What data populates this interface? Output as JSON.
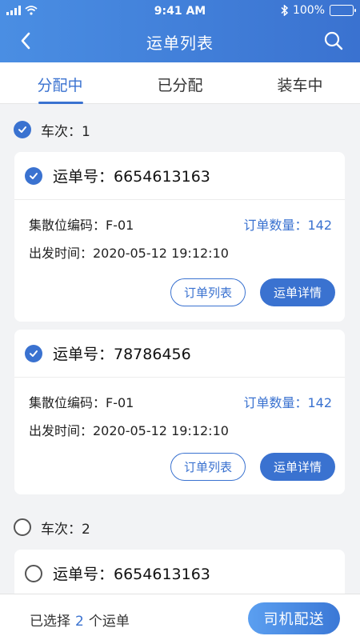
{
  "status_bar": {
    "time": "9:41 AM",
    "battery": "100%"
  },
  "header": {
    "title": "运单列表",
    "back_icon": "back-arrow-icon",
    "search_icon": "search-icon"
  },
  "tabs": [
    {
      "label": "分配中",
      "active": true
    },
    {
      "label": "已分配",
      "active": false
    },
    {
      "label": "装车中",
      "active": false
    }
  ],
  "groups": [
    {
      "label": "车次：1",
      "checked": true,
      "cards": [
        {
          "checked": true,
          "waybill": "运单号：6654613163",
          "location": "集散位编码：F-01",
          "order_count": "订单数量：142",
          "depart_time": "出发时间：2020-05-12  19:12:10",
          "btn_orders": "订单列表",
          "btn_detail": "运单详情"
        },
        {
          "checked": true,
          "waybill": "运单号：78786456",
          "location": "集散位编码：F-01",
          "order_count": "订单数量：142",
          "depart_time": "出发时间：2020-05-12  19:12:10",
          "btn_orders": "订单列表",
          "btn_detail": "运单详情"
        }
      ]
    },
    {
      "label": "车次：2",
      "checked": false,
      "cards": [
        {
          "checked": false,
          "waybill": "运单号：6654613163"
        }
      ]
    }
  ],
  "bottom": {
    "prefix": "已选择",
    "count": "2",
    "suffix": "个运单",
    "dispatch_label": "司机配送"
  },
  "colors": {
    "accent": "#3a72d0",
    "header_start": "#4a8ee3",
    "background": "#f2f3f5"
  }
}
